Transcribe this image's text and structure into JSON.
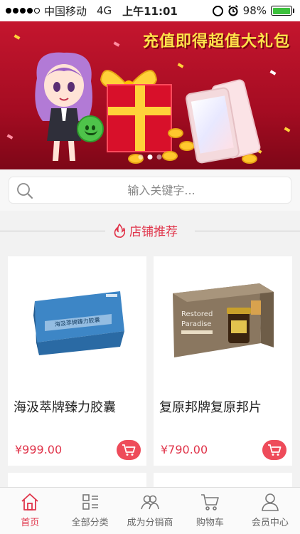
{
  "status_bar": {
    "carrier": "中国移动",
    "network": "4G",
    "time": "上午11:01",
    "battery": "98%"
  },
  "banner": {
    "title": "充值即得超值大礼包",
    "slide_count": 3,
    "active_slide": 1
  },
  "search": {
    "placeholder": "输入关键字..."
  },
  "section": {
    "title": "店铺推荐",
    "accent_color": "#e0344a"
  },
  "products": [
    {
      "name": "海汲萃牌臻力胶囊",
      "price": "¥999.00",
      "box_text": "海汲萃牌臻力胶囊"
    },
    {
      "name": "复原邦牌复原邦片",
      "price": "¥790.00",
      "box_text_en_1": "Restored",
      "box_text_en_2": "Paradise"
    }
  ],
  "tabbar": {
    "items": [
      {
        "label": "首页",
        "icon": "home-icon",
        "active": true
      },
      {
        "label": "全部分类",
        "icon": "category-icon",
        "active": false
      },
      {
        "label": "成为分销商",
        "icon": "distributor-icon",
        "active": false
      },
      {
        "label": "购物车",
        "icon": "cart-icon",
        "active": false
      },
      {
        "label": "会员中心",
        "icon": "user-icon",
        "active": false
      }
    ]
  }
}
